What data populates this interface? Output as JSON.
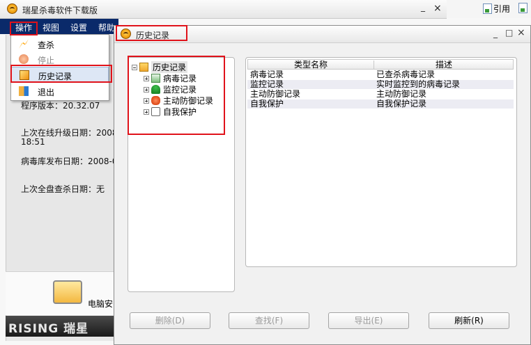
{
  "main_window": {
    "title": "瑞星杀毒软件下载版",
    "controls": {
      "minimize": "_",
      "close": "×"
    },
    "menu": [
      "操作",
      "视图",
      "设置",
      "帮助"
    ],
    "info": {
      "program_version": "程序版本：20.32.07",
      "last_update_line1": "上次在线升级日期：2008",
      "last_update_line2": "18:51",
      "virus_db_date": "病毒库发布日期：2008-0",
      "last_full_scan": "上次全盘查杀日期：无"
    },
    "promo_label": "电脑安",
    "brand": "RISING 瑞星"
  },
  "top_right_toolbar": {
    "item1": "引用"
  },
  "operations_menu": {
    "items": [
      {
        "label": "查杀",
        "icon": "scan-icon",
        "enabled": true
      },
      {
        "label": "停止",
        "icon": "stop-icon",
        "enabled": false
      },
      {
        "label": "历史记录",
        "icon": "history-icon",
        "enabled": true,
        "selected": true
      },
      {
        "label": "退出",
        "icon": "exit-icon",
        "enabled": true
      }
    ]
  },
  "history_window": {
    "title": "历史记录",
    "controls": {
      "minimize": "_",
      "maximize": "□",
      "close": "×"
    },
    "tree": {
      "root": "历史记录",
      "children": [
        "病毒记录",
        "监控记录",
        "主动防御记录",
        "自我保护"
      ]
    },
    "table": {
      "columns": [
        "类型名称",
        "描述"
      ],
      "rows": [
        [
          "病毒记录",
          "已查杀病毒记录"
        ],
        [
          "监控记录",
          "实时监控到的病毒记录"
        ],
        [
          "主动防御记录",
          "主动防御记录"
        ],
        [
          "自我保护",
          "自我保护记录"
        ]
      ]
    },
    "buttons": [
      {
        "label": "删除(D)",
        "enabled": false
      },
      {
        "label": "查找(F)",
        "enabled": false
      },
      {
        "label": "导出(E)",
        "enabled": false
      },
      {
        "label": "刷新(R)",
        "enabled": true
      }
    ]
  },
  "colors": {
    "menubar": "#0a2a6a",
    "highlight": "#e0121a",
    "selection": "#dde7f5"
  }
}
